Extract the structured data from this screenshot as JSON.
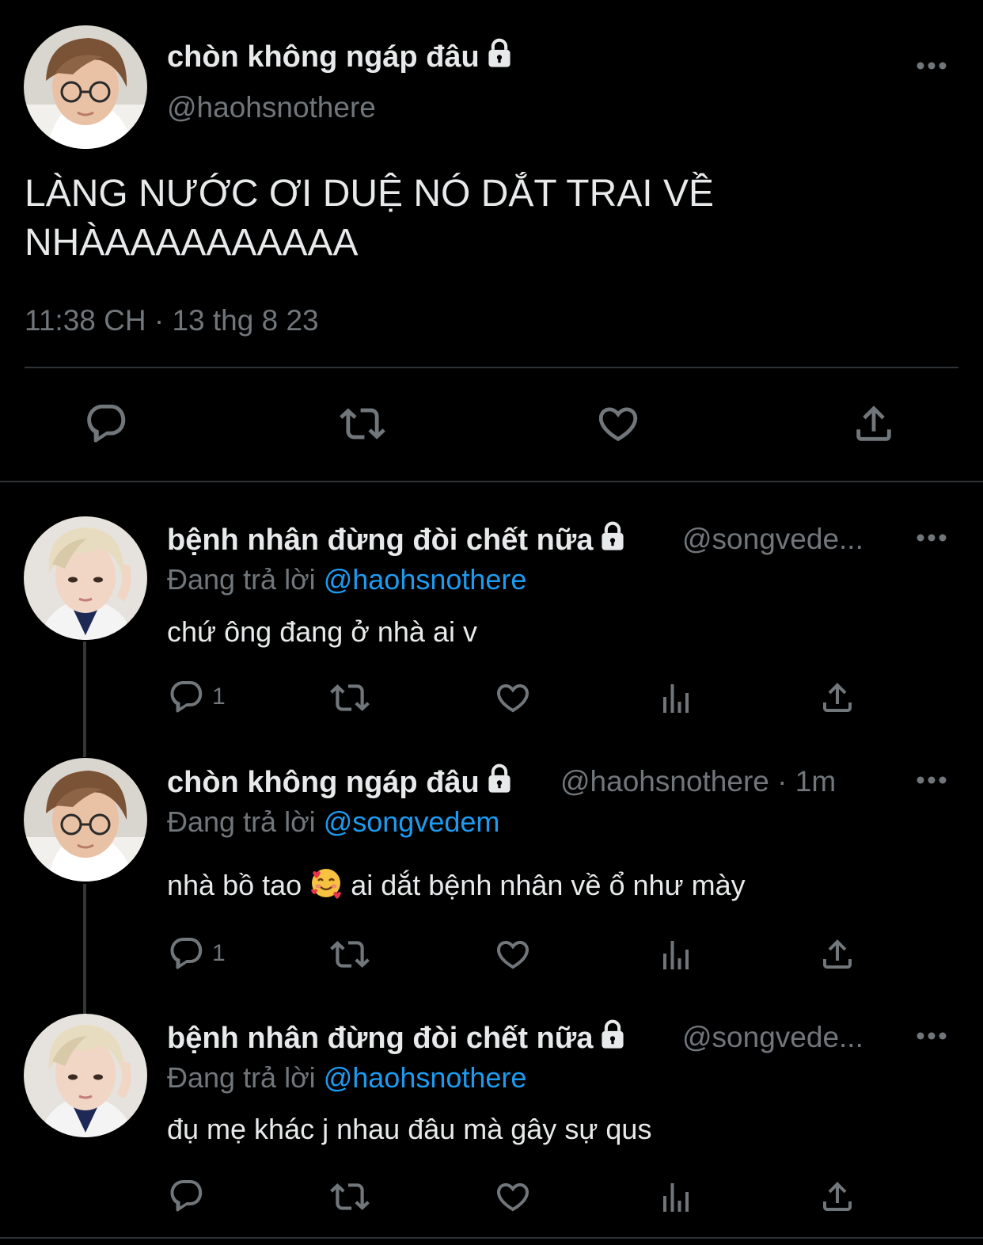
{
  "main_tweet": {
    "display_name": "chòn không ngáp đâu",
    "handle": "@haohsnothere",
    "text_line1": "LÀNG NƯỚC ƠI DUỆ NÓ DẮT TRAI VỀ",
    "text_line2": "NHÀAAAAAAAAAA",
    "timestamp": "11:38 CH · 13 thg 8 23"
  },
  "replies": [
    {
      "display_name": "bệnh nhân đừng đòi chết nữa",
      "handle": "@songvede...",
      "reply_prefix": "Đang trả lời",
      "reply_to": "@haohsnothere",
      "text": "chứ ông đang ở nhà ai v",
      "reply_count": "1"
    },
    {
      "display_name": "chòn không ngáp đâu",
      "handle": "@haohsnothere · 1m",
      "reply_prefix": "Đang trả lời",
      "reply_to": "@songvedem",
      "text_before_emoji": "nhà bồ tao",
      "text_after_emoji": "ai dắt bệnh nhân về ổ như mày",
      "reply_count": "1"
    },
    {
      "display_name": "bệnh nhân đừng đòi chết nữa",
      "handle": "@songvede...",
      "reply_prefix": "Đang trả lời",
      "reply_to": "@haohsnothere",
      "text": "đụ mẹ khác j nhau đâu mà gây sự qus",
      "reply_count": ""
    }
  ],
  "icons": [
    "reply-icon",
    "retweet-icon",
    "like-icon",
    "views-icon",
    "share-icon",
    "more-icon",
    "lock-icon",
    "smiling-face-with-hearts-emoji"
  ],
  "colors": {
    "background": "#000000",
    "text": "#e7e9ea",
    "secondary": "#71767b",
    "mention": "#1d9bf0",
    "divider": "#2f3336"
  }
}
